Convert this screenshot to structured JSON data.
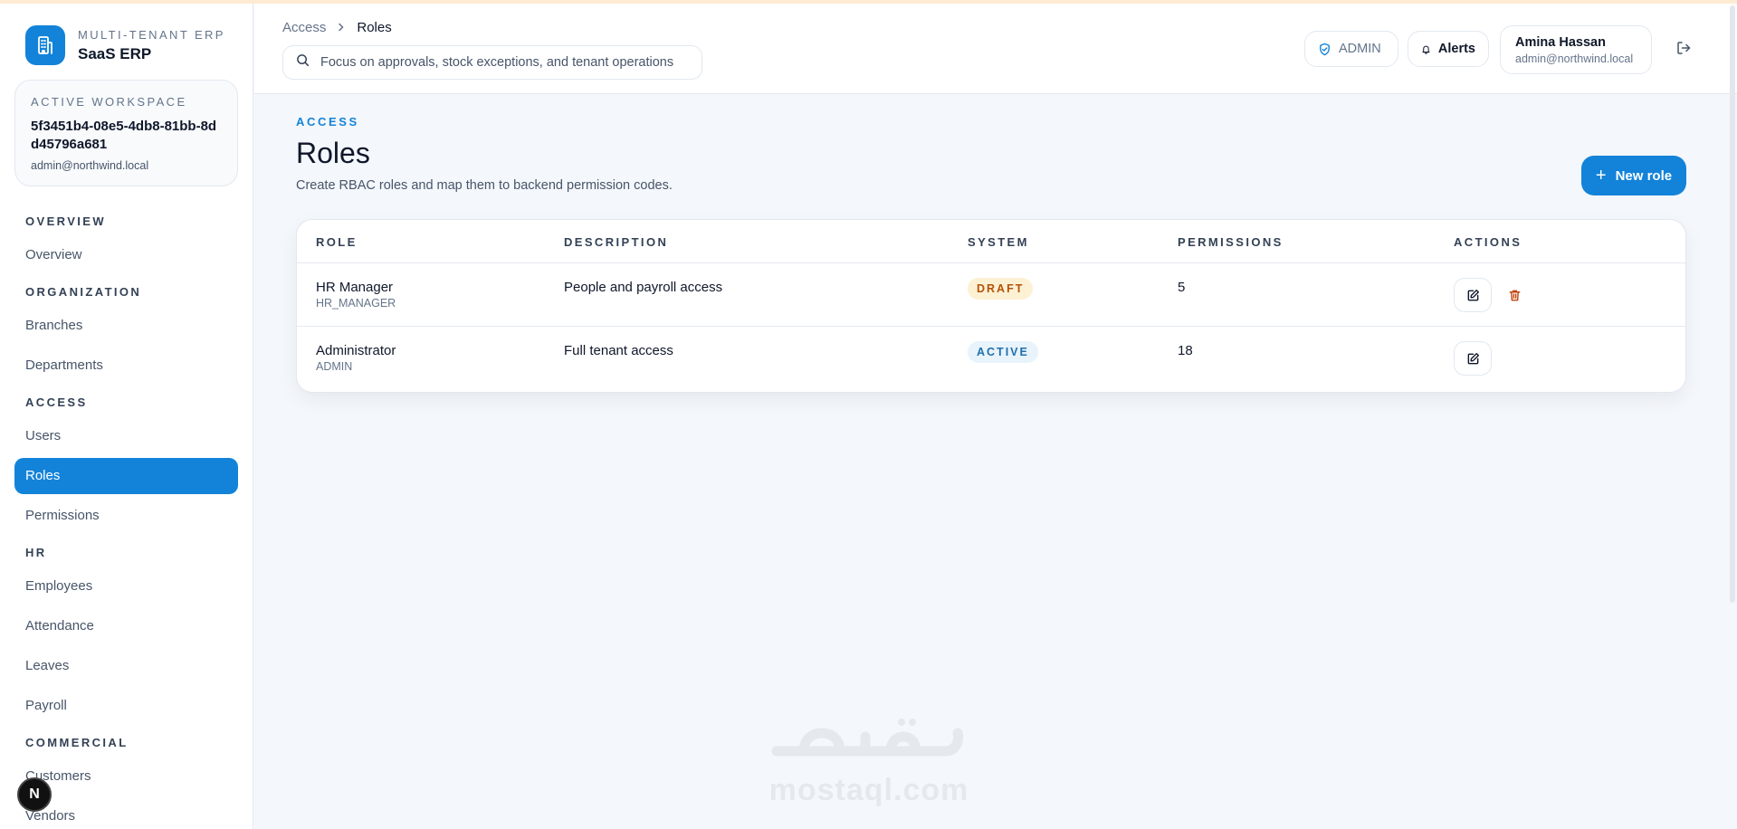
{
  "brand": {
    "eyebrow": "MULTI-TENANT ERP",
    "name": "SaaS ERP"
  },
  "workspace": {
    "label": "ACTIVE WORKSPACE",
    "id": "5f3451b4-08e5-4db8-81bb-8dd45796a681",
    "email": "admin@northwind.local"
  },
  "nav": {
    "overview": {
      "section": "OVERVIEW",
      "items": [
        "Overview"
      ]
    },
    "organization": {
      "section": "ORGANIZATION",
      "items": [
        "Branches",
        "Departments"
      ]
    },
    "access": {
      "section": "ACCESS",
      "items": [
        "Users",
        "Roles",
        "Permissions"
      ]
    },
    "hr": {
      "section": "HR",
      "items": [
        "Employees",
        "Attendance",
        "Leaves",
        "Payroll"
      ]
    },
    "commercial": {
      "section": "COMMERCIAL",
      "items": [
        "Customers",
        "Vendors"
      ]
    },
    "active_item": "Roles"
  },
  "header": {
    "breadcrumb": [
      "Access",
      "Roles"
    ],
    "search_placeholder": "Focus on approvals, stock exceptions, and tenant operations",
    "role_chip": "ADMIN",
    "alerts_label": "Alerts",
    "user": {
      "name": "Amina Hassan",
      "email": "admin@northwind.local"
    }
  },
  "page": {
    "eyebrow": "ACCESS",
    "title": "Roles",
    "subtitle": "Create RBAC roles and map them to backend permission codes.",
    "new_button": "New role"
  },
  "table": {
    "columns": [
      "ROLE",
      "DESCRIPTION",
      "SYSTEM",
      "PERMISSIONS",
      "ACTIONS"
    ],
    "rows": [
      {
        "name": "HR Manager",
        "code": "HR_MANAGER",
        "description": "People and payroll access",
        "system": "DRAFT",
        "permissions": "5"
      },
      {
        "name": "Administrator",
        "code": "ADMIN",
        "description": "Full tenant access",
        "system": "ACTIVE",
        "permissions": "18"
      }
    ]
  },
  "badge": {
    "letter": "N"
  },
  "watermark": {
    "latin": "mostaql.com"
  },
  "colors": {
    "accent": "#1383d9",
    "draft_text": "#b45309",
    "draft_bg": "#fdf1d4",
    "active_text": "#1e6fae",
    "active_bg": "#e8f3fb",
    "danger": "#c2410c"
  }
}
